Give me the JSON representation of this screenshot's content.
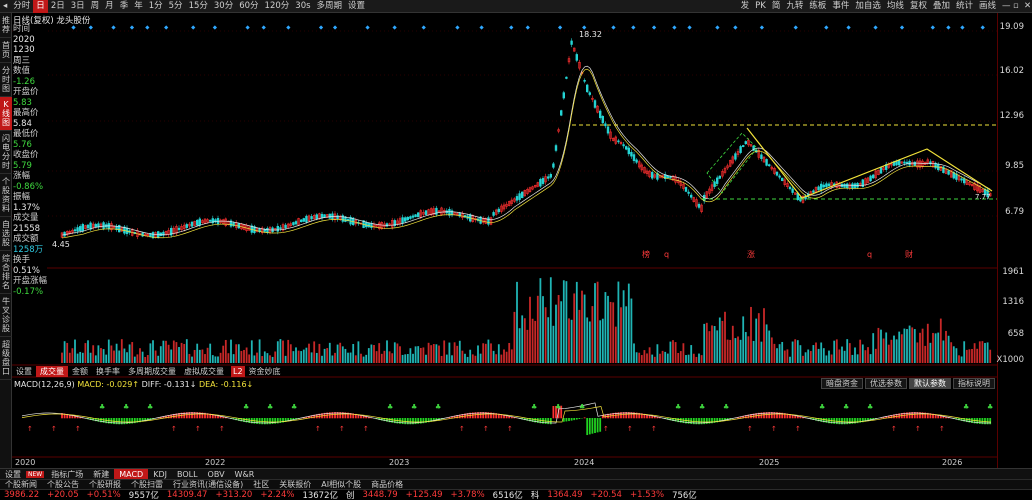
{
  "toolbar": {
    "left_items": [
      "分时",
      "日",
      "2日",
      "3日",
      "周",
      "月",
      "季",
      "年",
      "1分",
      "5分",
      "15分",
      "30分",
      "60分",
      "120分",
      "30s",
      "多周期",
      "设置"
    ],
    "active_index": 1,
    "right_items": [
      "发",
      "PK",
      "简",
      "九转",
      "练板",
      "事件",
      "加自选",
      "均线",
      "复权",
      "叠加",
      "统计",
      "画线"
    ]
  },
  "left_nav": [
    "推荐",
    "首页",
    "分时图",
    "K线图",
    "闪电分时",
    "个股资料",
    "自选股",
    "综合排名",
    "牛叉诊股",
    "超级盘口"
  ],
  "left_nav_active": 3,
  "stock_title": "日线(复权) 龙头股份",
  "info_panel": {
    "time_label": "时间",
    "date_year": "2020",
    "date_md": "1230",
    "weekday": "周三",
    "value_label": "数值",
    "value": "-1.26",
    "open_label": "开盘价",
    "open": "5.83",
    "high_label": "最高价",
    "high": "5.84",
    "low_label": "最低价",
    "low": "5.76",
    "close_label": "收盘价",
    "close": "5.79",
    "change_pct_label": "涨幅",
    "change_pct": "-0.86%",
    "amplitude_label": "振幅",
    "amplitude": "1.37%",
    "volume_label": "成交量",
    "volume": "21558",
    "amount_label": "成交额",
    "amount": "1258万",
    "turnover_label": "换手",
    "turnover": "0.51%",
    "open_change_label": "开盘涨幅",
    "open_change": "-0.17%"
  },
  "price_axis": [
    "19.09",
    "16.02",
    "12.96",
    "9.85",
    "6.79"
  ],
  "volume_axis": [
    "1961",
    "1316",
    "658",
    "X1000"
  ],
  "chart_labels": {
    "peak_price": "18.32",
    "low_mark": "4.45",
    "last_price": "7.77",
    "event_marks": [
      "榜",
      "q",
      "涨",
      "q",
      "财"
    ],
    "vol_tag": "3"
  },
  "sub_tabs": [
    "设置",
    "成交量",
    "金额",
    "换手率",
    "多周期成交量",
    "虚拟成交量",
    "资金妙底"
  ],
  "sub_tabs_active": 1,
  "sub_tab_badge": "L2",
  "macd_legend": {
    "name": "MACD(12,26,9)",
    "macd": "MACD: -0.029↑",
    "diff": "DIFF: -0.131↓",
    "dea": "DEA: -0.116↓"
  },
  "macd_buttons": [
    "暗盘资金",
    "优选参数",
    "默认参数",
    "指标说明"
  ],
  "macd_buttons_active": 2,
  "x_axis": [
    "2020",
    "2022",
    "2023",
    "2024",
    "2025",
    "2026"
  ],
  "bottom_tabs": [
    "设置",
    "指标广场",
    "新建",
    "MACD",
    "KDJ",
    "BOLL",
    "OBV",
    "W&R"
  ],
  "bottom_tabs_active": 3,
  "bottom_badge": "NEW",
  "news": [
    "个股新闻",
    "个股公告",
    "个股研报",
    "个股扫雷",
    "行业资讯(通信设备)",
    "社区",
    "关联报价",
    "AI相似个股",
    "商品价格"
  ],
  "status": {
    "index1": "3986.22",
    "index1_chg": "+20.05",
    "index1_pct": "+0.51%",
    "index1_amt": "9557亿",
    "index2": "14309.47",
    "index2_chg": "+313.20",
    "index2_pct": "+2.24%",
    "index2_amt": "13672亿",
    "label3": "创",
    "index3": "3448.79",
    "index3_chg": "+125.49",
    "index3_pct": "+3.78%",
    "index3_amt": "6516亿",
    "label4": "科",
    "index4": "1364.49",
    "index4_chg": "+20.54",
    "index4_pct": "+1.53%",
    "index4_amt": "756亿"
  }
}
